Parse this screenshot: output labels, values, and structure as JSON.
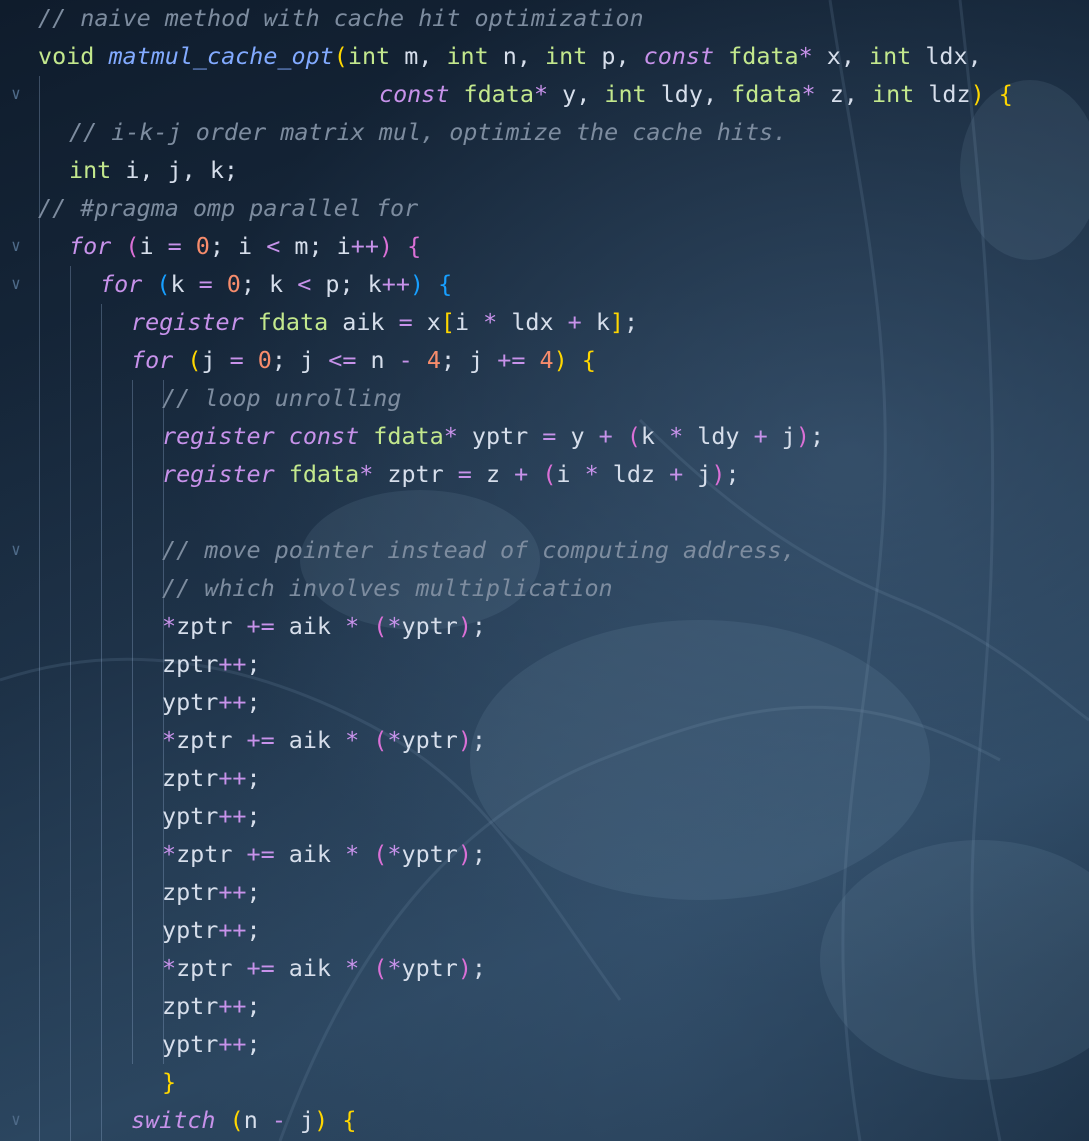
{
  "editor": {
    "lines": [
      {
        "fold": false,
        "tokens": [
          {
            "t": "// naive method with cache hit optimization",
            "c": "comment"
          }
        ]
      },
      {
        "fold": false,
        "tokens": [
          {
            "t": "void",
            "c": "type"
          },
          {
            "t": " ",
            "c": "id"
          },
          {
            "t": "matmul_cache_opt",
            "c": "fn"
          },
          {
            "t": "(",
            "c": "p1"
          },
          {
            "t": "int",
            "c": "type"
          },
          {
            "t": " m, ",
            "c": "id"
          },
          {
            "t": "int",
            "c": "type"
          },
          {
            "t": " n, ",
            "c": "id"
          },
          {
            "t": "int",
            "c": "type"
          },
          {
            "t": " p, ",
            "c": "id"
          },
          {
            "t": "const",
            "c": "kw"
          },
          {
            "t": " ",
            "c": "id"
          },
          {
            "t": "fdata",
            "c": "type"
          },
          {
            "t": "*",
            "c": "op"
          },
          {
            "t": " x, ",
            "c": "id"
          },
          {
            "t": "int",
            "c": "type"
          },
          {
            "t": " ldx,",
            "c": "id"
          }
        ]
      },
      {
        "fold": true,
        "tokens": [
          {
            "t": "const",
            "c": "kw"
          },
          {
            "t": " ",
            "c": "id"
          },
          {
            "t": "fdata",
            "c": "type"
          },
          {
            "t": "*",
            "c": "op"
          },
          {
            "t": " y, ",
            "c": "id"
          },
          {
            "t": "int",
            "c": "type"
          },
          {
            "t": " ldy, ",
            "c": "id"
          },
          {
            "t": "fdata",
            "c": "type"
          },
          {
            "t": "*",
            "c": "op"
          },
          {
            "t": " z, ",
            "c": "id"
          },
          {
            "t": "int",
            "c": "type"
          },
          {
            "t": " ldz",
            "c": "id"
          },
          {
            "t": ")",
            "c": "p1"
          },
          {
            "t": " ",
            "c": "id"
          },
          {
            "t": "{",
            "c": "p1"
          }
        ]
      },
      {
        "fold": false,
        "tokens": [
          {
            "t": "// i-k-j order matrix mul, optimize the cache hits.",
            "c": "comment"
          }
        ]
      },
      {
        "fold": false,
        "tokens": [
          {
            "t": "int",
            "c": "type"
          },
          {
            "t": " i, j, k;",
            "c": "id"
          }
        ]
      },
      {
        "fold": false,
        "tokens": [
          {
            "t": "// #pragma omp parallel for",
            "c": "comment"
          }
        ]
      },
      {
        "fold": true,
        "tokens": [
          {
            "t": "for",
            "c": "kw"
          },
          {
            "t": " ",
            "c": "id"
          },
          {
            "t": "(",
            "c": "p2"
          },
          {
            "t": "i ",
            "c": "id"
          },
          {
            "t": "=",
            "c": "op"
          },
          {
            "t": " ",
            "c": "id"
          },
          {
            "t": "0",
            "c": "num"
          },
          {
            "t": "; i ",
            "c": "id"
          },
          {
            "t": "<",
            "c": "op"
          },
          {
            "t": " m; i",
            "c": "id"
          },
          {
            "t": "++",
            "c": "op"
          },
          {
            "t": ")",
            "c": "p2"
          },
          {
            "t": " ",
            "c": "id"
          },
          {
            "t": "{",
            "c": "p2"
          }
        ]
      },
      {
        "fold": true,
        "tokens": [
          {
            "t": "for",
            "c": "kw"
          },
          {
            "t": " ",
            "c": "id"
          },
          {
            "t": "(",
            "c": "p3"
          },
          {
            "t": "k ",
            "c": "id"
          },
          {
            "t": "=",
            "c": "op"
          },
          {
            "t": " ",
            "c": "id"
          },
          {
            "t": "0",
            "c": "num"
          },
          {
            "t": "; k ",
            "c": "id"
          },
          {
            "t": "<",
            "c": "op"
          },
          {
            "t": " p; k",
            "c": "id"
          },
          {
            "t": "++",
            "c": "op"
          },
          {
            "t": ")",
            "c": "p3"
          },
          {
            "t": " ",
            "c": "id"
          },
          {
            "t": "{",
            "c": "p3"
          }
        ]
      },
      {
        "fold": false,
        "tokens": [
          {
            "t": "register",
            "c": "kw"
          },
          {
            "t": " ",
            "c": "id"
          },
          {
            "t": "fdata",
            "c": "type"
          },
          {
            "t": " aik ",
            "c": "id"
          },
          {
            "t": "=",
            "c": "op"
          },
          {
            "t": " x",
            "c": "id"
          },
          {
            "t": "[",
            "c": "p1"
          },
          {
            "t": "i ",
            "c": "id"
          },
          {
            "t": "*",
            "c": "op"
          },
          {
            "t": " ldx ",
            "c": "id"
          },
          {
            "t": "+",
            "c": "op"
          },
          {
            "t": " k",
            "c": "id"
          },
          {
            "t": "]",
            "c": "p1"
          },
          {
            "t": ";",
            "c": "id"
          }
        ]
      },
      {
        "fold": false,
        "tokens": [
          {
            "t": "for",
            "c": "kw"
          },
          {
            "t": " ",
            "c": "id"
          },
          {
            "t": "(",
            "c": "p1"
          },
          {
            "t": "j ",
            "c": "id"
          },
          {
            "t": "=",
            "c": "op"
          },
          {
            "t": " ",
            "c": "id"
          },
          {
            "t": "0",
            "c": "num"
          },
          {
            "t": "; j ",
            "c": "id"
          },
          {
            "t": "<=",
            "c": "op"
          },
          {
            "t": " n ",
            "c": "id"
          },
          {
            "t": "-",
            "c": "op"
          },
          {
            "t": " ",
            "c": "id"
          },
          {
            "t": "4",
            "c": "num"
          },
          {
            "t": "; j ",
            "c": "id"
          },
          {
            "t": "+=",
            "c": "op"
          },
          {
            "t": " ",
            "c": "id"
          },
          {
            "t": "4",
            "c": "num"
          },
          {
            "t": ")",
            "c": "p1"
          },
          {
            "t": " ",
            "c": "id"
          },
          {
            "t": "{",
            "c": "p1"
          }
        ]
      },
      {
        "fold": false,
        "tokens": [
          {
            "t": "// loop unrolling",
            "c": "comment"
          }
        ]
      },
      {
        "fold": false,
        "tokens": [
          {
            "t": "register",
            "c": "kw"
          },
          {
            "t": " ",
            "c": "id"
          },
          {
            "t": "const",
            "c": "kw"
          },
          {
            "t": " ",
            "c": "id"
          },
          {
            "t": "fdata",
            "c": "type"
          },
          {
            "t": "*",
            "c": "op"
          },
          {
            "t": " yptr ",
            "c": "id"
          },
          {
            "t": "=",
            "c": "op"
          },
          {
            "t": " y ",
            "c": "id"
          },
          {
            "t": "+",
            "c": "op"
          },
          {
            "t": " ",
            "c": "id"
          },
          {
            "t": "(",
            "c": "p2"
          },
          {
            "t": "k ",
            "c": "id"
          },
          {
            "t": "*",
            "c": "op"
          },
          {
            "t": " ldy ",
            "c": "id"
          },
          {
            "t": "+",
            "c": "op"
          },
          {
            "t": " j",
            "c": "id"
          },
          {
            "t": ")",
            "c": "p2"
          },
          {
            "t": ";",
            "c": "id"
          }
        ]
      },
      {
        "fold": false,
        "tokens": [
          {
            "t": "register",
            "c": "kw"
          },
          {
            "t": " ",
            "c": "id"
          },
          {
            "t": "fdata",
            "c": "type"
          },
          {
            "t": "*",
            "c": "op"
          },
          {
            "t": " zptr ",
            "c": "id"
          },
          {
            "t": "=",
            "c": "op"
          },
          {
            "t": " z ",
            "c": "id"
          },
          {
            "t": "+",
            "c": "op"
          },
          {
            "t": " ",
            "c": "id"
          },
          {
            "t": "(",
            "c": "p2"
          },
          {
            "t": "i ",
            "c": "id"
          },
          {
            "t": "*",
            "c": "op"
          },
          {
            "t": " ldz ",
            "c": "id"
          },
          {
            "t": "+",
            "c": "op"
          },
          {
            "t": " j",
            "c": "id"
          },
          {
            "t": ")",
            "c": "p2"
          },
          {
            "t": ";",
            "c": "id"
          }
        ]
      },
      {
        "fold": false,
        "tokens": []
      },
      {
        "fold": true,
        "tokens": [
          {
            "t": "// move pointer instead of computing address,",
            "c": "comment"
          }
        ]
      },
      {
        "fold": false,
        "tokens": [
          {
            "t": "// which involves multiplication",
            "c": "comment"
          }
        ]
      },
      {
        "fold": false,
        "tokens": [
          {
            "t": "*",
            "c": "op"
          },
          {
            "t": "zptr ",
            "c": "id"
          },
          {
            "t": "+=",
            "c": "op"
          },
          {
            "t": " aik ",
            "c": "id"
          },
          {
            "t": "*",
            "c": "op"
          },
          {
            "t": " ",
            "c": "id"
          },
          {
            "t": "(",
            "c": "p2"
          },
          {
            "t": "*",
            "c": "op"
          },
          {
            "t": "yptr",
            "c": "id"
          },
          {
            "t": ")",
            "c": "p2"
          },
          {
            "t": ";",
            "c": "id"
          }
        ]
      },
      {
        "fold": false,
        "tokens": [
          {
            "t": "zptr",
            "c": "id"
          },
          {
            "t": "++",
            "c": "op"
          },
          {
            "t": ";",
            "c": "id"
          }
        ]
      },
      {
        "fold": false,
        "tokens": [
          {
            "t": "yptr",
            "c": "id"
          },
          {
            "t": "++",
            "c": "op"
          },
          {
            "t": ";",
            "c": "id"
          }
        ]
      },
      {
        "fold": false,
        "tokens": [
          {
            "t": "*",
            "c": "op"
          },
          {
            "t": "zptr ",
            "c": "id"
          },
          {
            "t": "+=",
            "c": "op"
          },
          {
            "t": " aik ",
            "c": "id"
          },
          {
            "t": "*",
            "c": "op"
          },
          {
            "t": " ",
            "c": "id"
          },
          {
            "t": "(",
            "c": "p2"
          },
          {
            "t": "*",
            "c": "op"
          },
          {
            "t": "yptr",
            "c": "id"
          },
          {
            "t": ")",
            "c": "p2"
          },
          {
            "t": ";",
            "c": "id"
          }
        ]
      },
      {
        "fold": false,
        "tokens": [
          {
            "t": "zptr",
            "c": "id"
          },
          {
            "t": "++",
            "c": "op"
          },
          {
            "t": ";",
            "c": "id"
          }
        ]
      },
      {
        "fold": false,
        "tokens": [
          {
            "t": "yptr",
            "c": "id"
          },
          {
            "t": "++",
            "c": "op"
          },
          {
            "t": ";",
            "c": "id"
          }
        ]
      },
      {
        "fold": false,
        "tokens": [
          {
            "t": "*",
            "c": "op"
          },
          {
            "t": "zptr ",
            "c": "id"
          },
          {
            "t": "+=",
            "c": "op"
          },
          {
            "t": " aik ",
            "c": "id"
          },
          {
            "t": "*",
            "c": "op"
          },
          {
            "t": " ",
            "c": "id"
          },
          {
            "t": "(",
            "c": "p2"
          },
          {
            "t": "*",
            "c": "op"
          },
          {
            "t": "yptr",
            "c": "id"
          },
          {
            "t": ")",
            "c": "p2"
          },
          {
            "t": ";",
            "c": "id"
          }
        ]
      },
      {
        "fold": false,
        "tokens": [
          {
            "t": "zptr",
            "c": "id"
          },
          {
            "t": "++",
            "c": "op"
          },
          {
            "t": ";",
            "c": "id"
          }
        ]
      },
      {
        "fold": false,
        "tokens": [
          {
            "t": "yptr",
            "c": "id"
          },
          {
            "t": "++",
            "c": "op"
          },
          {
            "t": ";",
            "c": "id"
          }
        ]
      },
      {
        "fold": false,
        "tokens": [
          {
            "t": "*",
            "c": "op"
          },
          {
            "t": "zptr ",
            "c": "id"
          },
          {
            "t": "+=",
            "c": "op"
          },
          {
            "t": " aik ",
            "c": "id"
          },
          {
            "t": "*",
            "c": "op"
          },
          {
            "t": " ",
            "c": "id"
          },
          {
            "t": "(",
            "c": "p2"
          },
          {
            "t": "*",
            "c": "op"
          },
          {
            "t": "yptr",
            "c": "id"
          },
          {
            "t": ")",
            "c": "p2"
          },
          {
            "t": ";",
            "c": "id"
          }
        ]
      },
      {
        "fold": false,
        "tokens": [
          {
            "t": "zptr",
            "c": "id"
          },
          {
            "t": "++",
            "c": "op"
          },
          {
            "t": ";",
            "c": "id"
          }
        ]
      },
      {
        "fold": false,
        "tokens": [
          {
            "t": "yptr",
            "c": "id"
          },
          {
            "t": "++",
            "c": "op"
          },
          {
            "t": ";",
            "c": "id"
          }
        ]
      },
      {
        "fold": false,
        "tokens": [
          {
            "t": "}",
            "c": "p1"
          }
        ]
      },
      {
        "fold": true,
        "tokens": [
          {
            "t": "switch",
            "c": "kw"
          },
          {
            "t": " ",
            "c": "id"
          },
          {
            "t": "(",
            "c": "p1"
          },
          {
            "t": "n ",
            "c": "id"
          },
          {
            "t": "-",
            "c": "op"
          },
          {
            "t": " j",
            "c": "id"
          },
          {
            "t": ")",
            "c": "p1"
          },
          {
            "t": " ",
            "c": "id"
          },
          {
            "t": "{",
            "c": "p1"
          }
        ]
      }
    ]
  },
  "theme": {
    "comment": "#7d8c9f",
    "type": "#c3e88d",
    "keyword": "#c792ea",
    "function": "#82aaff",
    "number": "#f78c6c",
    "text": "#d6deeb",
    "bracket_1": "#ffd700",
    "bracket_2": "#da70d6",
    "bracket_3": "#179fff"
  },
  "icons": {
    "fold": "chevron-down-icon"
  }
}
